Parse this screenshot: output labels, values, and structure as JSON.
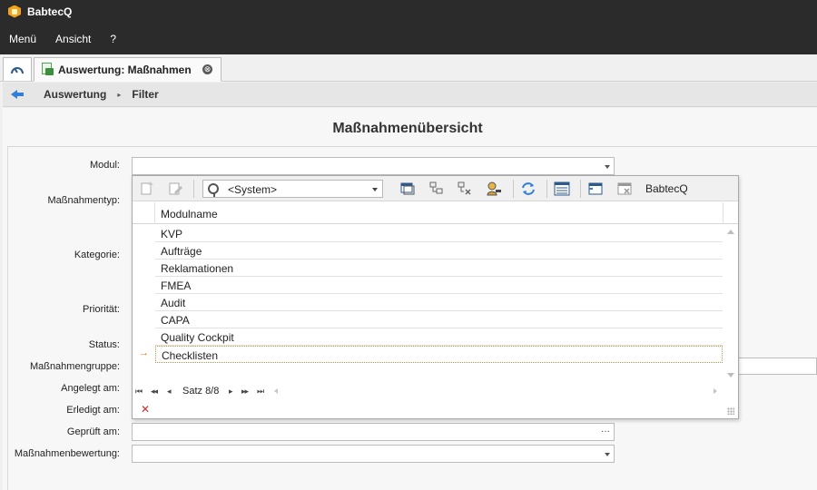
{
  "app": {
    "title": "BabtecQ"
  },
  "menu": {
    "items": [
      "Menü",
      "Ansicht",
      "?"
    ]
  },
  "tabs": {
    "active_label": "Auswertung: Maßnahmen",
    "close_glyph": "⊗"
  },
  "breadcrumb": {
    "items": [
      "Auswertung",
      "Filter"
    ],
    "separator": "▸"
  },
  "page": {
    "title": "Maßnahmenübersicht"
  },
  "form": {
    "labels": {
      "modul": "Modul:",
      "massnahmentyp": "Maßnahmentyp:",
      "kategorie": "Kategorie:",
      "prioritaet": "Priorität:",
      "status": "Status:",
      "massnahmengruppe": "Maßnahmengruppe:",
      "angelegt": "Angelegt am:",
      "erledigt": "Erledigt am:",
      "geprueft": "Geprüft am:",
      "bewertung": "Maßnahmenbewertung:"
    },
    "modul_value": "",
    "ellipsis": "···"
  },
  "popup": {
    "system_combo": "<System>",
    "toolbar_text": "BabtecQ",
    "column_header": "Modulname",
    "rows": [
      "KVP",
      "Aufträge",
      "Reklamationen",
      "FMEA",
      "Audit",
      "CAPA",
      "Quality Cockpit",
      "Checklisten"
    ],
    "selected_index": 7,
    "row_indicator": "→",
    "record_text": "Satz 8/8",
    "nav": {
      "first": "⏮",
      "prev_page": "◂◂",
      "prev": "◂",
      "next": "▸",
      "next_page": "▸▸",
      "last": "⏭"
    },
    "clear_glyph": "✕"
  },
  "colors": {
    "titlebar": "#2b2b2b",
    "accent_blue": "#2f7fd6",
    "selection_indicator": "#d9791a",
    "clear_red": "#d32b2b",
    "logo_orange": "#f2a31b"
  }
}
